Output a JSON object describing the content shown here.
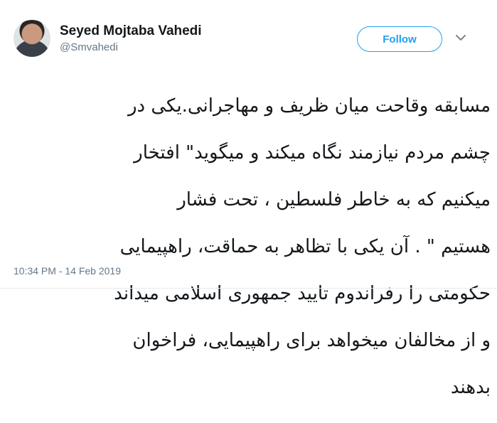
{
  "author": {
    "name": "Seyed Mojtaba Vahedi",
    "handle": "@Smvahedi"
  },
  "follow_label": "Follow",
  "tweet": {
    "lines": [
      "مسابقه وقاحت میان ظریف و مهاجرانی.یکی در",
      "چشم مردم نیازمند نگاه میکند و میگوید\" افتخار",
      "میکنیم که به خاطر فلسطین ، تحت فشار",
      "هستیم \" . آن یکی با تظاهر به حماقت،  راهپیمایی",
      "حکومتی را رفراندوم تایید جمهوری اسلامی میداند",
      "و از مخالفان میخواهد  برای راهپیمایی، فراخوان",
      "بدهند"
    ]
  },
  "timestamp": "10:34 PM - 14 Feb 2019",
  "colors": {
    "accent": "#1da1f2",
    "secondary_text": "#657786",
    "primary_text": "#14171a"
  },
  "icons": {
    "more": "chevron-down-icon"
  }
}
